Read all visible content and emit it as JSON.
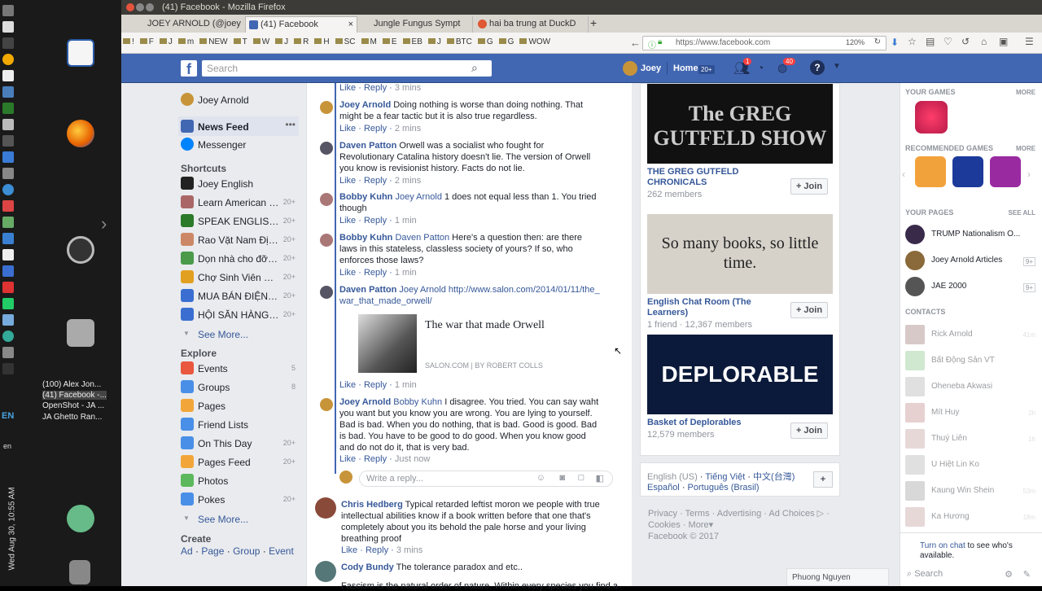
{
  "window": {
    "title": "(41) Facebook - Mozilla Firefox"
  },
  "tabs": [
    {
      "label": "JOEY ARNOLD (@joey"
    },
    {
      "label": "(41) Facebook"
    },
    {
      "label": "Jungle Fungus Sympt"
    },
    {
      "label": "hai ba trung at DuckD"
    }
  ],
  "bookmarks": [
    "!",
    "F",
    "J",
    "m",
    "NEW",
    "T",
    "W",
    "J",
    "R",
    "H",
    "SC",
    "M",
    "E",
    "EB",
    "J",
    "BTC",
    "G",
    "G",
    "WOW"
  ],
  "url": "https://www.facebook.com",
  "zoom": "120%",
  "desktop": {
    "clock": "Wed Aug 30, 10:55 AM",
    "lang": "EN",
    "lang2": "en",
    "tasks": [
      "(100) Alex Jon...",
      "(41) Facebook -...",
      "OpenShot - JA ...",
      "JA Ghetto Ran..."
    ]
  },
  "header": {
    "logo": "f",
    "search_placeholder": "Search",
    "user": "Joey",
    "home": "Home",
    "home_count": "20+",
    "friend_badge": "1",
    "notif_badge": "40"
  },
  "leftnav": {
    "profile": "Joey Arnold",
    "news_feed": "News Feed",
    "messenger": "Messenger",
    "shortcuts_h": "Shortcuts",
    "shortcuts": [
      {
        "label": "Joey English",
        "count": ""
      },
      {
        "label": "Learn American En...",
        "count": "20+"
      },
      {
        "label": "SPEAK ENGLISH F...",
        "count": "20+"
      },
      {
        "label": "Rao Vặt Nam Định",
        "count": "20+"
      },
      {
        "label": "Dọn nhà cho đỡ chật",
        "count": "20+"
      },
      {
        "label": "Chợ Sinh Viên Sư ...",
        "count": "20+"
      },
      {
        "label": "MUA BÁN ĐIỆN TH...",
        "count": "20+"
      },
      {
        "label": "HỘI SĂN HÀNG M...",
        "count": "20+"
      }
    ],
    "see_more": "See More...",
    "explore_h": "Explore",
    "explore": [
      {
        "label": "Events",
        "count": "5"
      },
      {
        "label": "Groups",
        "count": "8"
      },
      {
        "label": "Pages",
        "count": ""
      },
      {
        "label": "Friend Lists",
        "count": ""
      },
      {
        "label": "On This Day",
        "count": "20+"
      },
      {
        "label": "Pages Feed",
        "count": "20+"
      },
      {
        "label": "Photos",
        "count": ""
      },
      {
        "label": "Pokes",
        "count": "20+"
      }
    ],
    "see_more2": "See More...",
    "create_h": "Create",
    "create": [
      "Ad",
      "Page",
      "Group",
      "Event"
    ]
  },
  "comments": {
    "like": "Like",
    "reply": "Reply",
    "items": [
      {
        "name": "Joey Arnold",
        "tag": "",
        "text": "Doing nothing is worse than doing nothing. That might be a fear tactic but it is also true regardless.",
        "time": "2 mins"
      },
      {
        "name": "Daven Patton",
        "tag": "",
        "text": "Orwell was a socialist who fought for Revolutionary Catalina history doesn't lie. The version of Orwell you know is revisionist history. Facts do not lie.",
        "time": "2 mins"
      },
      {
        "name": "Bobby Kuhn",
        "tag": "Joey Arnold",
        "text": "1 does not equal less than 1. You tried though",
        "time": "1 min"
      },
      {
        "name": "Bobby Kuhn",
        "tag": "Daven Patton",
        "text": "Here's a question then: are there laws in this stateless, classless society of yours? If so, who enforces those laws?",
        "time": "1 min"
      },
      {
        "name": "Daven Patton",
        "tag": "Joey Arnold",
        "text": "",
        "time": "1 min"
      },
      {
        "name": "Joey Arnold",
        "tag": "Bobby Kuhn",
        "text": "I disagree. You tried. You can say waht you want but you know you are wrong. You are lying to yourself. Bad is bad. When you do nothing, that is bad. Good is good. Bad is bad. You have to be good to do good. When you know good and do not do it, that is very bad.",
        "time": "Just now"
      }
    ],
    "top_time": "3 mins",
    "link_url": "http://www.salon.com/2014/01/11/the_war_that_made_orwell/",
    "link_title": "The war that made Orwell",
    "link_source": "SALON.COM",
    "link_author": "BY ROBERT COLLS",
    "write_reply": "Write a reply...",
    "outer": [
      {
        "name": "Chris Hedberg",
        "text": "Typical retarded leftist moron we people with true intellectual abilities know if a book written before that one that's completely about you its behold the pale horse and your living breathing proof",
        "time": "3 mins"
      },
      {
        "name": "Cody Bundy",
        "text": "The tolerance paradox and etc..",
        "time": ""
      }
    ],
    "cut_text": "Fascism is the natural order of nature. Within every species you find a"
  },
  "groups": [
    {
      "name": "THE GREG GUTFELD CHRONICALS",
      "meta": "262 members",
      "img_text": "The GREG GUTFELD SHOW"
    },
    {
      "name": "English Chat Room (The Learners)",
      "meta": "1 friend · 12,367 members",
      "img_text": "So many books, so little time."
    },
    {
      "name": "Basket of Deplorables",
      "meta": "12,579 members",
      "img_text": "DEPLORABLE"
    }
  ],
  "join_label": "Join",
  "lang": {
    "current": "English (US)",
    "others": [
      "Tiếng Việt",
      "中文(台灣)",
      "Español",
      "Português (Brasil)"
    ]
  },
  "footer": {
    "links": [
      "Privacy",
      "Terms",
      "Advertising",
      "Ad Choices",
      "Cookies",
      "More"
    ],
    "copyright": "Facebook © 2017"
  },
  "rightside": {
    "your_games": "YOUR GAMES",
    "more": "MORE",
    "recommended": "RECOMMENDED GAMES",
    "your_pages": "YOUR PAGES",
    "see_all": "SEE ALL",
    "pages": [
      {
        "name": "TRUMP Nationalism O...",
        "badge": ""
      },
      {
        "name": "Joey Arnold Articles",
        "badge": "9+"
      },
      {
        "name": "JAE 2000",
        "badge": "9+"
      }
    ],
    "contacts_h": "CONTACTS",
    "contacts": [
      {
        "name": "Rick Arnold",
        "time": "41m"
      },
      {
        "name": "Bất Động Sản VT",
        "time": ""
      },
      {
        "name": "Oheneba Akwasi",
        "time": ""
      },
      {
        "name": "Mít Huy",
        "time": "2h"
      },
      {
        "name": "Thuý Liên",
        "time": "1h"
      },
      {
        "name": "U Hiệt Lin Ko",
        "time": ""
      },
      {
        "name": "Kaung Win Shein",
        "time": "53m"
      },
      {
        "name": "Ka Hương",
        "time": "18m"
      }
    ],
    "chat_link": "Turn on chat",
    "chat_text": " to see who's available.",
    "search": "Search",
    "chat_tab": "Phuong Nguyen"
  },
  "colors": {
    "fb_blue": "#4267b2",
    "link": "#365899",
    "bg": "#e9ebee"
  }
}
